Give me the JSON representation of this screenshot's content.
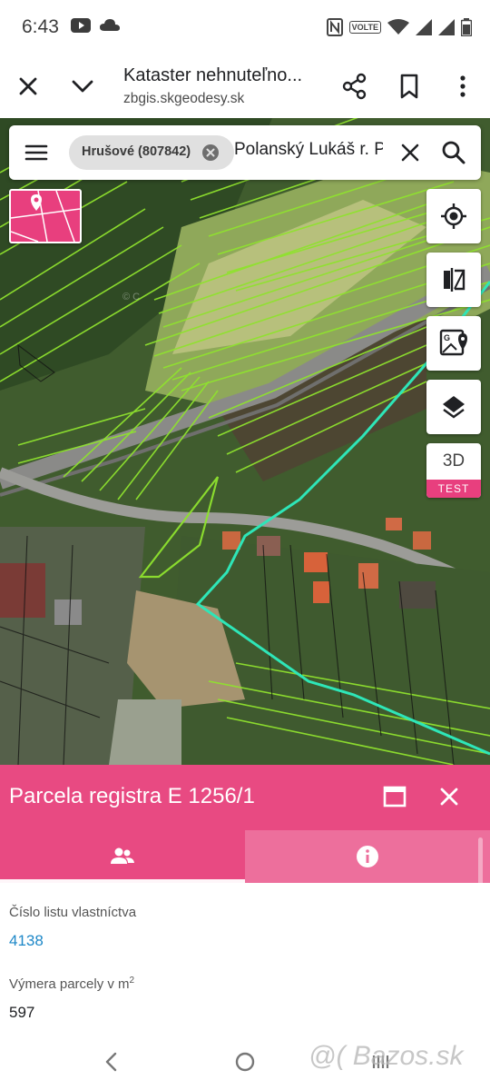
{
  "status_bar": {
    "time": "6:43",
    "left_icons": [
      "youtube-icon",
      "cloud-icon"
    ],
    "right_icons": [
      "nfc-icon",
      "volte-icon",
      "wifi-icon",
      "signal-icon",
      "signal-icon",
      "battery-icon"
    ],
    "volte_label": "VOLTE"
  },
  "browser": {
    "title": "Kataster nehnuteľno...",
    "url": "zbgis.skgeodesy.sk"
  },
  "search": {
    "chip_label": "Hrušové (807842)",
    "query": "Polanský Lukáš r. P"
  },
  "map_controls": {
    "btn_3d_label": "3D",
    "btn_3d_badge": "TEST"
  },
  "panel": {
    "title": "Parcela registra E 1256/1",
    "fields": [
      {
        "label": "Číslo listu vlastníctva",
        "value": "4138",
        "value_color": "#1e88c8"
      },
      {
        "label": "Výmera parcely v m",
        "label_sup": "2",
        "value": "597",
        "value_color": "#202124"
      }
    ]
  },
  "watermark": "@( Bazos.sk",
  "colors": {
    "accent": "#e84a82",
    "tab_inactive": "#ed6f9c",
    "parcel_outline": "#8fe22e",
    "boundary": "#2ee6b8",
    "link": "#1e88c8"
  }
}
